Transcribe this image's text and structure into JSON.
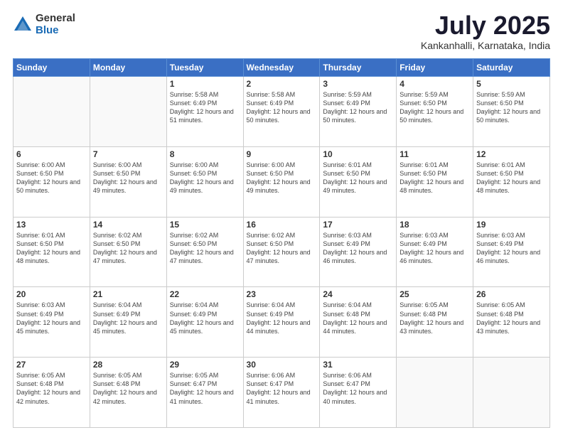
{
  "logo": {
    "general": "General",
    "blue": "Blue"
  },
  "header": {
    "month": "July 2025",
    "location": "Kankanhalli, Karnataka, India"
  },
  "days_of_week": [
    "Sunday",
    "Monday",
    "Tuesday",
    "Wednesday",
    "Thursday",
    "Friday",
    "Saturday"
  ],
  "weeks": [
    [
      {
        "day": "",
        "info": ""
      },
      {
        "day": "",
        "info": ""
      },
      {
        "day": "1",
        "info": "Sunrise: 5:58 AM\nSunset: 6:49 PM\nDaylight: 12 hours and 51 minutes."
      },
      {
        "day": "2",
        "info": "Sunrise: 5:58 AM\nSunset: 6:49 PM\nDaylight: 12 hours and 50 minutes."
      },
      {
        "day": "3",
        "info": "Sunrise: 5:59 AM\nSunset: 6:49 PM\nDaylight: 12 hours and 50 minutes."
      },
      {
        "day": "4",
        "info": "Sunrise: 5:59 AM\nSunset: 6:50 PM\nDaylight: 12 hours and 50 minutes."
      },
      {
        "day": "5",
        "info": "Sunrise: 5:59 AM\nSunset: 6:50 PM\nDaylight: 12 hours and 50 minutes."
      }
    ],
    [
      {
        "day": "6",
        "info": "Sunrise: 6:00 AM\nSunset: 6:50 PM\nDaylight: 12 hours and 50 minutes."
      },
      {
        "day": "7",
        "info": "Sunrise: 6:00 AM\nSunset: 6:50 PM\nDaylight: 12 hours and 49 minutes."
      },
      {
        "day": "8",
        "info": "Sunrise: 6:00 AM\nSunset: 6:50 PM\nDaylight: 12 hours and 49 minutes."
      },
      {
        "day": "9",
        "info": "Sunrise: 6:00 AM\nSunset: 6:50 PM\nDaylight: 12 hours and 49 minutes."
      },
      {
        "day": "10",
        "info": "Sunrise: 6:01 AM\nSunset: 6:50 PM\nDaylight: 12 hours and 49 minutes."
      },
      {
        "day": "11",
        "info": "Sunrise: 6:01 AM\nSunset: 6:50 PM\nDaylight: 12 hours and 48 minutes."
      },
      {
        "day": "12",
        "info": "Sunrise: 6:01 AM\nSunset: 6:50 PM\nDaylight: 12 hours and 48 minutes."
      }
    ],
    [
      {
        "day": "13",
        "info": "Sunrise: 6:01 AM\nSunset: 6:50 PM\nDaylight: 12 hours and 48 minutes."
      },
      {
        "day": "14",
        "info": "Sunrise: 6:02 AM\nSunset: 6:50 PM\nDaylight: 12 hours and 47 minutes."
      },
      {
        "day": "15",
        "info": "Sunrise: 6:02 AM\nSunset: 6:50 PM\nDaylight: 12 hours and 47 minutes."
      },
      {
        "day": "16",
        "info": "Sunrise: 6:02 AM\nSunset: 6:50 PM\nDaylight: 12 hours and 47 minutes."
      },
      {
        "day": "17",
        "info": "Sunrise: 6:03 AM\nSunset: 6:49 PM\nDaylight: 12 hours and 46 minutes."
      },
      {
        "day": "18",
        "info": "Sunrise: 6:03 AM\nSunset: 6:49 PM\nDaylight: 12 hours and 46 minutes."
      },
      {
        "day": "19",
        "info": "Sunrise: 6:03 AM\nSunset: 6:49 PM\nDaylight: 12 hours and 46 minutes."
      }
    ],
    [
      {
        "day": "20",
        "info": "Sunrise: 6:03 AM\nSunset: 6:49 PM\nDaylight: 12 hours and 45 minutes."
      },
      {
        "day": "21",
        "info": "Sunrise: 6:04 AM\nSunset: 6:49 PM\nDaylight: 12 hours and 45 minutes."
      },
      {
        "day": "22",
        "info": "Sunrise: 6:04 AM\nSunset: 6:49 PM\nDaylight: 12 hours and 45 minutes."
      },
      {
        "day": "23",
        "info": "Sunrise: 6:04 AM\nSunset: 6:49 PM\nDaylight: 12 hours and 44 minutes."
      },
      {
        "day": "24",
        "info": "Sunrise: 6:04 AM\nSunset: 6:48 PM\nDaylight: 12 hours and 44 minutes."
      },
      {
        "day": "25",
        "info": "Sunrise: 6:05 AM\nSunset: 6:48 PM\nDaylight: 12 hours and 43 minutes."
      },
      {
        "day": "26",
        "info": "Sunrise: 6:05 AM\nSunset: 6:48 PM\nDaylight: 12 hours and 43 minutes."
      }
    ],
    [
      {
        "day": "27",
        "info": "Sunrise: 6:05 AM\nSunset: 6:48 PM\nDaylight: 12 hours and 42 minutes."
      },
      {
        "day": "28",
        "info": "Sunrise: 6:05 AM\nSunset: 6:48 PM\nDaylight: 12 hours and 42 minutes."
      },
      {
        "day": "29",
        "info": "Sunrise: 6:05 AM\nSunset: 6:47 PM\nDaylight: 12 hours and 41 minutes."
      },
      {
        "day": "30",
        "info": "Sunrise: 6:06 AM\nSunset: 6:47 PM\nDaylight: 12 hours and 41 minutes."
      },
      {
        "day": "31",
        "info": "Sunrise: 6:06 AM\nSunset: 6:47 PM\nDaylight: 12 hours and 40 minutes."
      },
      {
        "day": "",
        "info": ""
      },
      {
        "day": "",
        "info": ""
      }
    ]
  ]
}
